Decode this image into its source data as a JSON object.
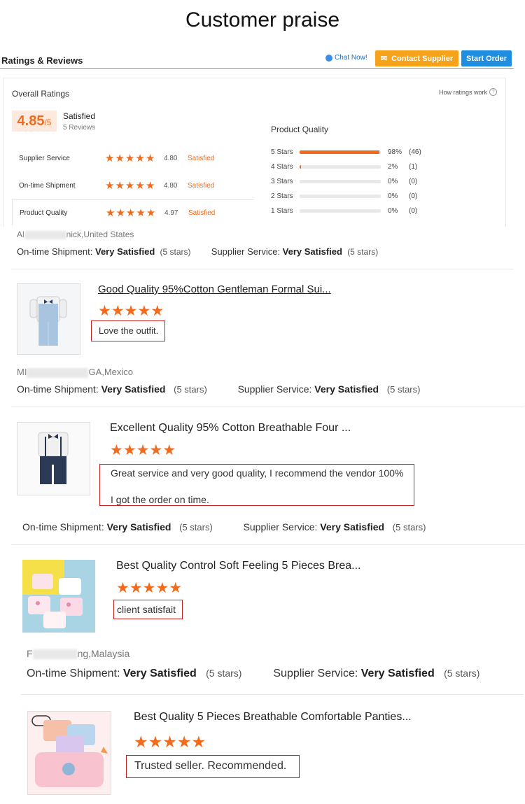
{
  "page_title": "Customer praise",
  "header": {
    "title": "Ratings & Reviews",
    "chat_label": "Chat Now!",
    "contact_label": "Contact Supplier",
    "start_label": "Start Order"
  },
  "overall": {
    "label": "Overall Ratings",
    "how_link": "How ratings work",
    "score": "4.85",
    "score_max": "/5",
    "satisfaction": "Satisfied",
    "review_count": "5 Reviews",
    "categories": [
      {
        "name": "Supplier Service",
        "score": "4.80",
        "label": "Satisfied",
        "stars": 5
      },
      {
        "name": "On-time Shipment",
        "score": "4.80",
        "label": "Satisfied",
        "stars": 5
      },
      {
        "name": "Product Quality",
        "score": "4.97",
        "label": "Satisfied",
        "stars": 5
      }
    ],
    "breakdown_title": "Product Quality",
    "breakdown": [
      {
        "label": "5 Stars",
        "pct": "98%",
        "count": "(46)",
        "fraction": 0.98
      },
      {
        "label": "4 Stars",
        "pct": "2%",
        "count": "(1)",
        "fraction": 0.02
      },
      {
        "label": "3 Stars",
        "pct": "0%",
        "count": "(0)",
        "fraction": 0
      },
      {
        "label": "2 Stars",
        "pct": "0%",
        "count": "(0)",
        "fraction": 0
      },
      {
        "label": "1 Stars",
        "pct": "0%",
        "count": "(0)",
        "fraction": 0
      }
    ]
  },
  "labels": {
    "ontime": "On-time Shipment: ",
    "supplier": "Supplier Service: ",
    "very_satisfied": "Very Satisfied",
    "five_stars": "(5 stars)"
  },
  "reviews": [
    {
      "reviewer_prefix": "Al",
      "reviewer_suffix": "nick,United States"
    },
    {
      "reviewer_prefix": "MI",
      "reviewer_suffix": "GA,Mexico",
      "title": "Good Quality 95%Cotton Gentleman Formal Sui...",
      "comment": "Love the outfit.",
      "rating": 5
    },
    {
      "title": "Excellent Quality 95% Cotton Breathable Four ...",
      "comment_line1": "Great service and very good quality, I recommend the vendor 100%",
      "comment_line2": "I got the order on time.",
      "rating": 5
    },
    {
      "reviewer_prefix": "F",
      "reviewer_suffix": "ng,Malaysia",
      "title": "Best Quality Control Soft Feeling 5 Pieces Brea...",
      "comment": "client satisfait",
      "rating": 5
    },
    {
      "title": "Best Quality 5 Pieces Breathable Comfortable Panties...",
      "comment": "Trusted seller. Recommended.",
      "rating": 5
    }
  ],
  "colors": {
    "accent": "#f26b1d",
    "contact": "#f7a21b",
    "start": "#1f8ee0",
    "comment_border": "#c42020"
  }
}
